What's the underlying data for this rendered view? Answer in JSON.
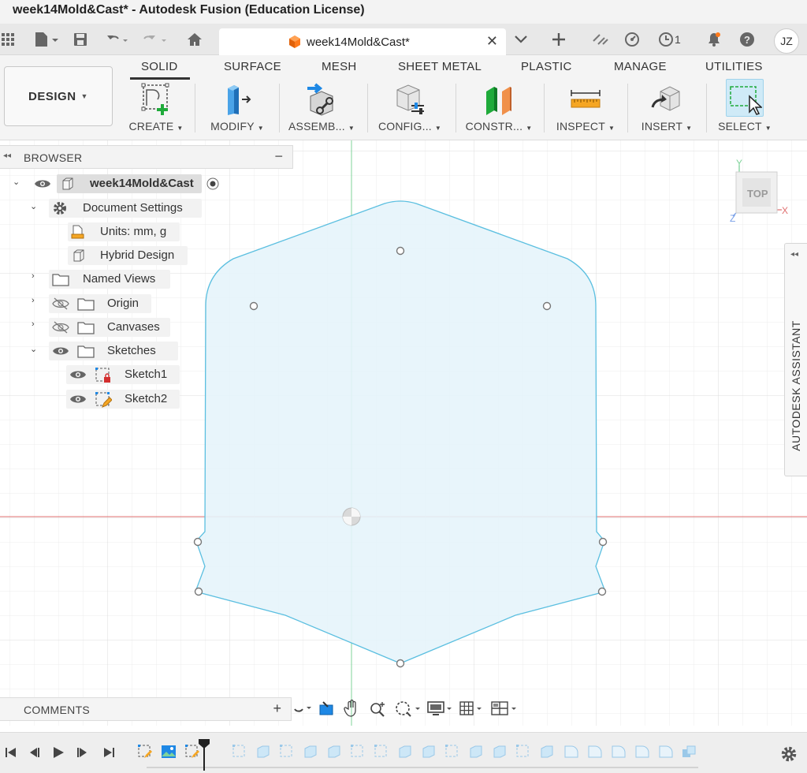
{
  "window": {
    "title": "week14Mold&Cast* - Autodesk Fusion (Education License)"
  },
  "tabbar": {
    "doc_tab_label": "week14Mold&Cast*",
    "job_count": "1",
    "avatar_initials": "JZ"
  },
  "toolbar": {
    "design_label": "DESIGN",
    "workspace_tabs": [
      "SOLID",
      "SURFACE",
      "MESH",
      "SHEET METAL",
      "PLASTIC",
      "MANAGE",
      "UTILITIES"
    ],
    "tools": [
      "CREATE",
      "MODIFY",
      "ASSEMB...",
      "CONFIG...",
      "CONSTR...",
      "INSPECT",
      "INSERT",
      "SELECT"
    ]
  },
  "browser": {
    "title": "BROWSER",
    "root_label": "week14Mold&Cast",
    "document_settings": "Document Settings",
    "units": "Units: mm, g",
    "hybrid_design": "Hybrid Design",
    "named_views": "Named Views",
    "origin": "Origin",
    "canvases": "Canvases",
    "sketches": "Sketches",
    "sketch1": "Sketch1",
    "sketch2": "Sketch2"
  },
  "viewcube": {
    "face_label": "TOP",
    "axis_y": "Y",
    "axis_x": "X",
    "axis_z": "Z"
  },
  "assistant": {
    "label": "AUTODESK ASSISTANT"
  },
  "comments": {
    "title": "COMMENTS"
  },
  "colors": {
    "sketch_fill": "#e6f4fb",
    "sketch_stroke": "#5bbfe0",
    "x_axis": "#e07070",
    "y_axis": "#7fd39a",
    "grid": "#e6e6e6",
    "tab_accent": "#ff7a1a",
    "select_highlight": "#cfeaf7"
  }
}
